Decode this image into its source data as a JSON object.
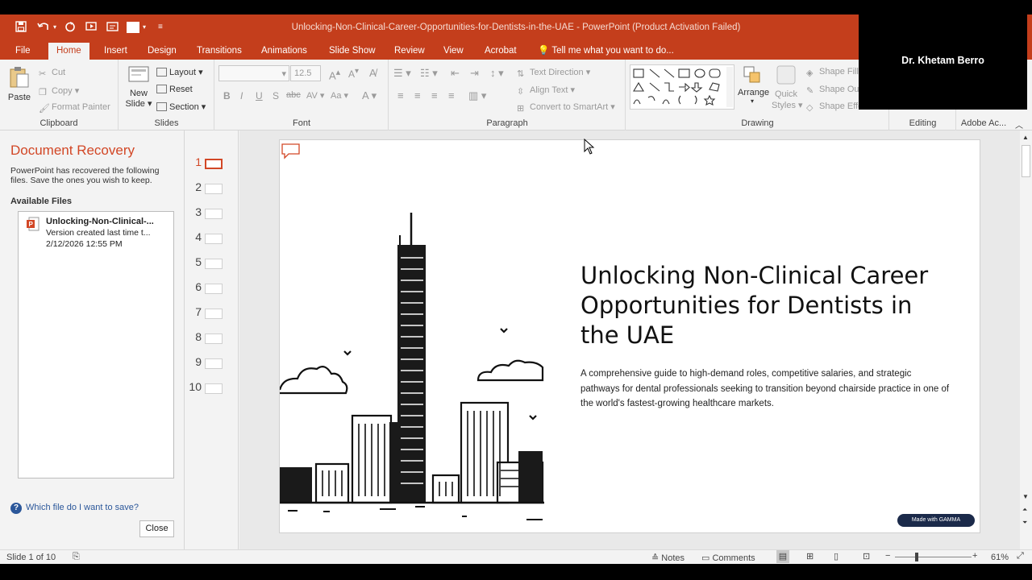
{
  "window": {
    "title": "Unlocking-Non-Clinical-Career-Opportunities-for-Dentists-in-the-UAE - PowerPoint (Product Activation Failed)"
  },
  "tabs": [
    "File",
    "Home",
    "Insert",
    "Design",
    "Transitions",
    "Animations",
    "Slide Show",
    "Review",
    "View",
    "Acrobat"
  ],
  "tell_me": "Tell me what you want to do...",
  "ribbon": {
    "clipboard": {
      "paste": "Paste",
      "cut": "Cut",
      "copy": "Copy",
      "format_painter": "Format Painter",
      "label": "Clipboard"
    },
    "slides": {
      "new_slide_1": "New",
      "new_slide_2": "Slide",
      "layout": "Layout",
      "reset": "Reset",
      "section": "Section",
      "label": "Slides"
    },
    "font": {
      "font_size": "12.5",
      "label": "Font"
    },
    "paragraph": {
      "text_direction": "Text Direction",
      "align_text": "Align Text",
      "convert_smartart": "Convert to SmartArt",
      "label": "Paragraph"
    },
    "drawing": {
      "arrange": "Arrange",
      "quick_styles_1": "Quick",
      "quick_styles_2": "Styles",
      "shape_fill": "Shape Fill",
      "shape_outline": "Shape Ou",
      "shape_effects": "Shape Effe",
      "label": "Drawing"
    },
    "editing": {
      "label": "Editing"
    },
    "adobe": {
      "label": "Adobe Ac..."
    }
  },
  "video": {
    "name": "Dr. Khetam Berro"
  },
  "recovery": {
    "title": "Document Recovery",
    "desc": "PowerPoint has recovered the following files.  Save the ones you wish to keep.",
    "available": "Available Files",
    "file": {
      "name": "Unlocking-Non-Clinical-...",
      "sub": "Version created last time t...",
      "date": "2/12/2026 12:55 PM"
    },
    "help": "Which file do I want to save?",
    "close": "Close"
  },
  "thumbnails": [
    "1",
    "2",
    "3",
    "4",
    "5",
    "6",
    "7",
    "8",
    "9",
    "10"
  ],
  "slide": {
    "title": "Unlocking Non-Clinical Career Opportunities for Dentists in the UAE",
    "subtitle": "A comprehensive guide to high-demand roles, competitive salaries, and strategic pathways for dental professionals seeking to transition beyond chairside practice in one of the world's fastest-growing healthcare markets.",
    "badge": "Made with GAMMA"
  },
  "status": {
    "slide": "Slide 1 of 10",
    "notes": "Notes",
    "comments": "Comments",
    "zoom": "61%"
  },
  "colors": {
    "accent": "#c43e1c",
    "recovery_title": "#d24726"
  }
}
